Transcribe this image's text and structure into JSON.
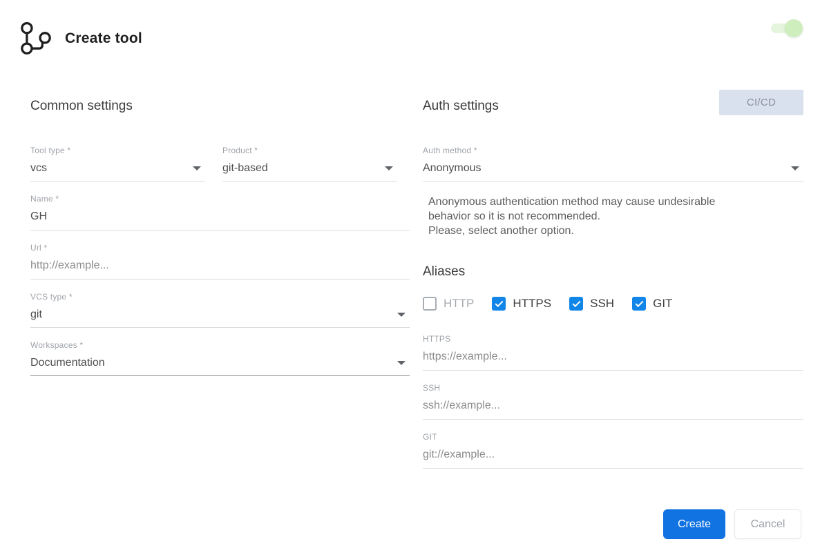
{
  "header": {
    "title": "Create tool",
    "toggle_state": "on"
  },
  "common": {
    "heading": "Common settings",
    "fields": {
      "tool_type": {
        "label": "Tool type *",
        "value": "vcs"
      },
      "product": {
        "label": "Product *",
        "value": "git-based"
      },
      "name": {
        "label": "Name *",
        "value": "GH"
      },
      "url": {
        "label": "Url *",
        "placeholder": "http://example..."
      },
      "vcs_type": {
        "label": "VCS type *",
        "value": "git"
      },
      "workspaces": {
        "label": "Workspaces *",
        "value": "Documentation"
      }
    }
  },
  "auth": {
    "heading": "Auth settings",
    "cicd_button_label": "CI/CD",
    "auth_method": {
      "label": "Auth method *",
      "value": "Anonymous"
    },
    "warning_lines": [
      "Anonymous authentication method may cause undesirable",
      "behavior so it is not recommended.",
      "Please, select another option."
    ]
  },
  "aliases": {
    "heading": "Aliases",
    "checkboxes": [
      {
        "label": "HTTP",
        "checked": false
      },
      {
        "label": "HTTPS",
        "checked": true
      },
      {
        "label": "SSH",
        "checked": true
      },
      {
        "label": "GIT",
        "checked": true
      }
    ],
    "fields": {
      "https": {
        "label": "HTTPS",
        "placeholder": "https://example..."
      },
      "ssh": {
        "label": "SSH",
        "placeholder": "ssh://example..."
      },
      "git": {
        "label": "GIT",
        "placeholder": "git://example..."
      }
    }
  },
  "footer": {
    "create_label": "Create",
    "cancel_label": "Cancel"
  },
  "colors": {
    "primary_blue": "#1172e2",
    "checkbox_blue": "#1285e8",
    "toggle_track_green": "#e6f5de",
    "toggle_knob_green": "#cfeebd",
    "cicd_bg": "#d9e0ee"
  }
}
